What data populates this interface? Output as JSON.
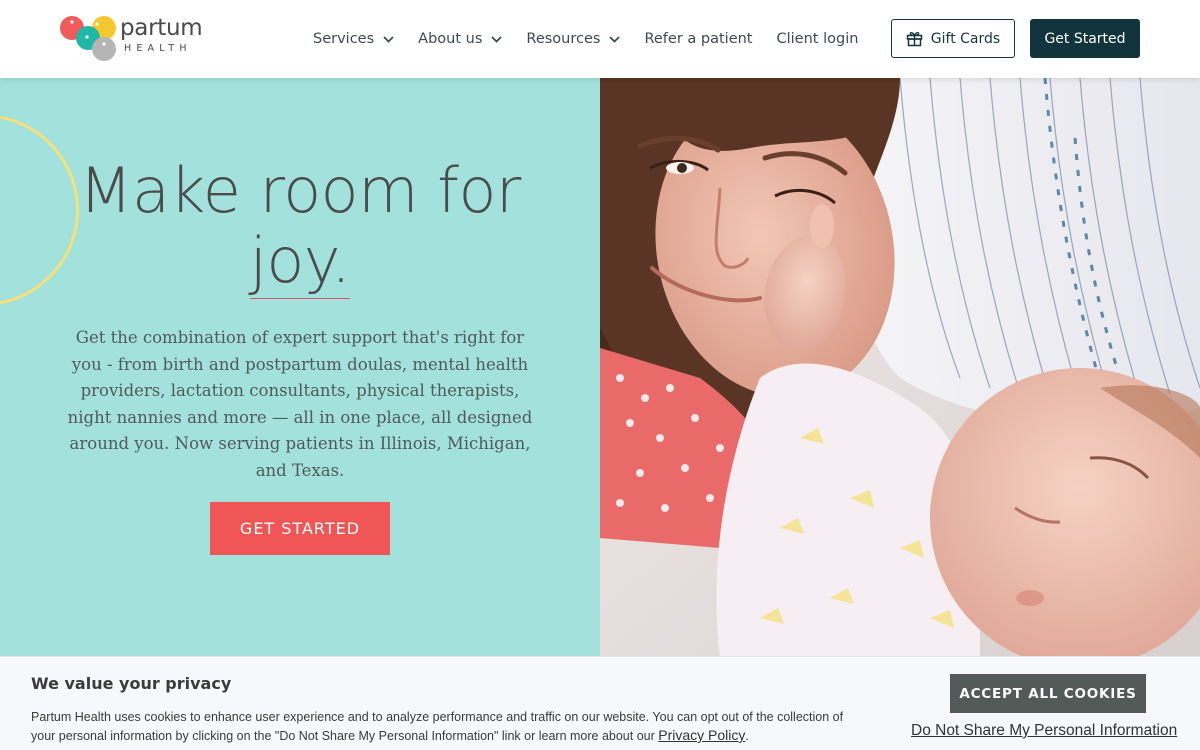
{
  "header": {
    "logo_word": "partum",
    "logo_sub": "HEALTH",
    "nav": [
      {
        "label": "Services",
        "has_dropdown": true
      },
      {
        "label": "About us",
        "has_dropdown": true
      },
      {
        "label": "Resources",
        "has_dropdown": true
      },
      {
        "label": "Refer a patient",
        "has_dropdown": false
      },
      {
        "label": "Client login",
        "has_dropdown": false
      }
    ],
    "gift_cards_label": "Gift Cards",
    "gift_icon": "gift-icon",
    "get_started_label": "Get Started"
  },
  "hero": {
    "title_line1": "Make room for",
    "title_line2": "joy.",
    "description": "Get the combination of expert support that's right for you - from birth and postpartum doulas, mental health providers, lactation consultants, physical therapists, night nannies and more — all in one place, all designed around you. Now serving patients in Illinois, Michigan, and Texas.",
    "cta_label": "GET STARTED"
  },
  "cookie_banner": {
    "title": "We value your privacy",
    "text": "Partum Health uses cookies to enhance user experience and to analyze performance and traffic on our website. You can opt out of the collection of your personal information by clicking on the \"Do Not Share My Personal Information\" link or learn more about our",
    "privacy_link": "Privacy Policy",
    "accept_label": "ACCEPT ALL COOKIES",
    "dns_link": "Do Not Share My Personal Information"
  },
  "colors": {
    "hero_bg": "#a3e1dc",
    "cta": "#f05656",
    "dark_button": "#12343c",
    "accept_button": "#545a58",
    "deco_circle": "#f4e17a"
  }
}
